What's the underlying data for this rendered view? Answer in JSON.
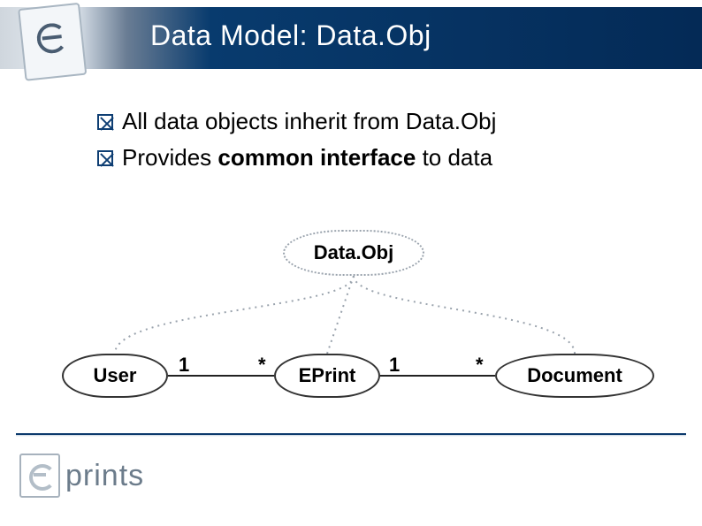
{
  "title": "Data Model: Data.Obj",
  "bullets": [
    {
      "pre": "All data objects inherit from Data.Obj",
      "bold": "",
      "post": ""
    },
    {
      "pre": "Provides ",
      "bold": "common interface",
      "post": " to data"
    }
  ],
  "diagram": {
    "root": "Data.Obj",
    "children": [
      "User",
      "EPrint",
      "Document"
    ],
    "cardinalities": {
      "user_to_eprint": {
        "from": "1",
        "to": "*"
      },
      "eprint_to_document": {
        "from": "1",
        "to": "*"
      }
    }
  },
  "footer_logo_text": "prints"
}
